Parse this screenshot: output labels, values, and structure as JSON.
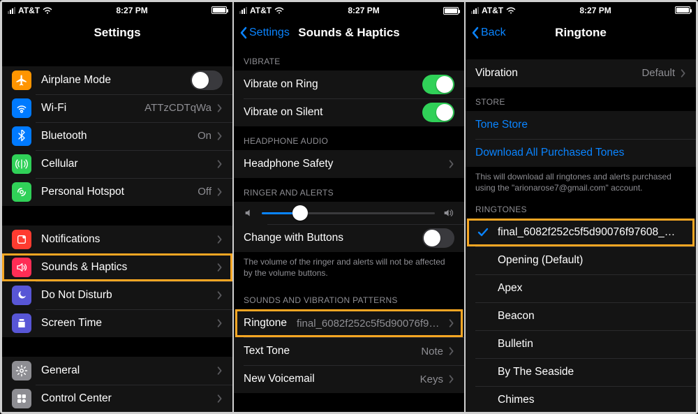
{
  "status": {
    "carrier": "AT&T",
    "time": "8:27 PM"
  },
  "panel1": {
    "title": "Settings",
    "items_group1": [
      {
        "name": "airplane-mode",
        "label": "Airplane Mode",
        "icon_bg": "#ff9500",
        "type": "toggle",
        "toggle_on": false
      },
      {
        "name": "wifi",
        "label": "Wi-Fi",
        "icon_bg": "#007aff",
        "value": "ATTzCDTqWa"
      },
      {
        "name": "bluetooth",
        "label": "Bluetooth",
        "icon_bg": "#007aff",
        "value": "On"
      },
      {
        "name": "cellular",
        "label": "Cellular",
        "icon_bg": "#30d158"
      },
      {
        "name": "personal-hotspot",
        "label": "Personal Hotspot",
        "icon_bg": "#30d158",
        "value": "Off"
      }
    ],
    "items_group2": [
      {
        "name": "notifications",
        "label": "Notifications",
        "icon_bg": "#ff3b30"
      },
      {
        "name": "sounds-haptics",
        "label": "Sounds & Haptics",
        "icon_bg": "#ff2d55",
        "highlight": true
      },
      {
        "name": "do-not-disturb",
        "label": "Do Not Disturb",
        "icon_bg": "#5856d6"
      },
      {
        "name": "screen-time",
        "label": "Screen Time",
        "icon_bg": "#5856d6"
      }
    ],
    "items_group3": [
      {
        "name": "general",
        "label": "General",
        "icon_bg": "#8e8e93"
      },
      {
        "name": "control-center",
        "label": "Control Center",
        "icon_bg": "#8e8e93"
      }
    ]
  },
  "panel2": {
    "back": "Settings",
    "title": "Sounds & Haptics",
    "vibrate_header": "VIBRATE",
    "vibrate_ring": "Vibrate on Ring",
    "vibrate_silent": "Vibrate on Silent",
    "headphone_header": "HEADPHONE AUDIO",
    "headphone_safety": "Headphone Safety",
    "ringer_header": "RINGER AND ALERTS",
    "change_buttons": "Change with Buttons",
    "volume_note": "The volume of the ringer and alerts will not be affected by the volume buttons.",
    "patterns_header": "SOUNDS AND VIBRATION PATTERNS",
    "ringtone_label": "Ringtone",
    "ringtone_value": "final_6082f252c5f5d90076f97…",
    "texttone_label": "Text Tone",
    "texttone_value": "Note",
    "voicemail_label": "New Voicemail",
    "voicemail_value": "Keys"
  },
  "panel3": {
    "back": "Back",
    "title": "Ringtone",
    "vibration_label": "Vibration",
    "vibration_value": "Default",
    "store_header": "STORE",
    "tone_store": "Tone Store",
    "download_all": "Download All Purchased Tones",
    "download_note": "This will download all ringtones and alerts purchased using the \"arionarose7@gmail.com\" account.",
    "ringtones_header": "RINGTONES",
    "selected_tone": "final_6082f252c5f5d90076f97608_5…",
    "tones": [
      "Opening (Default)",
      "Apex",
      "Beacon",
      "Bulletin",
      "By The Seaside",
      "Chimes"
    ]
  }
}
